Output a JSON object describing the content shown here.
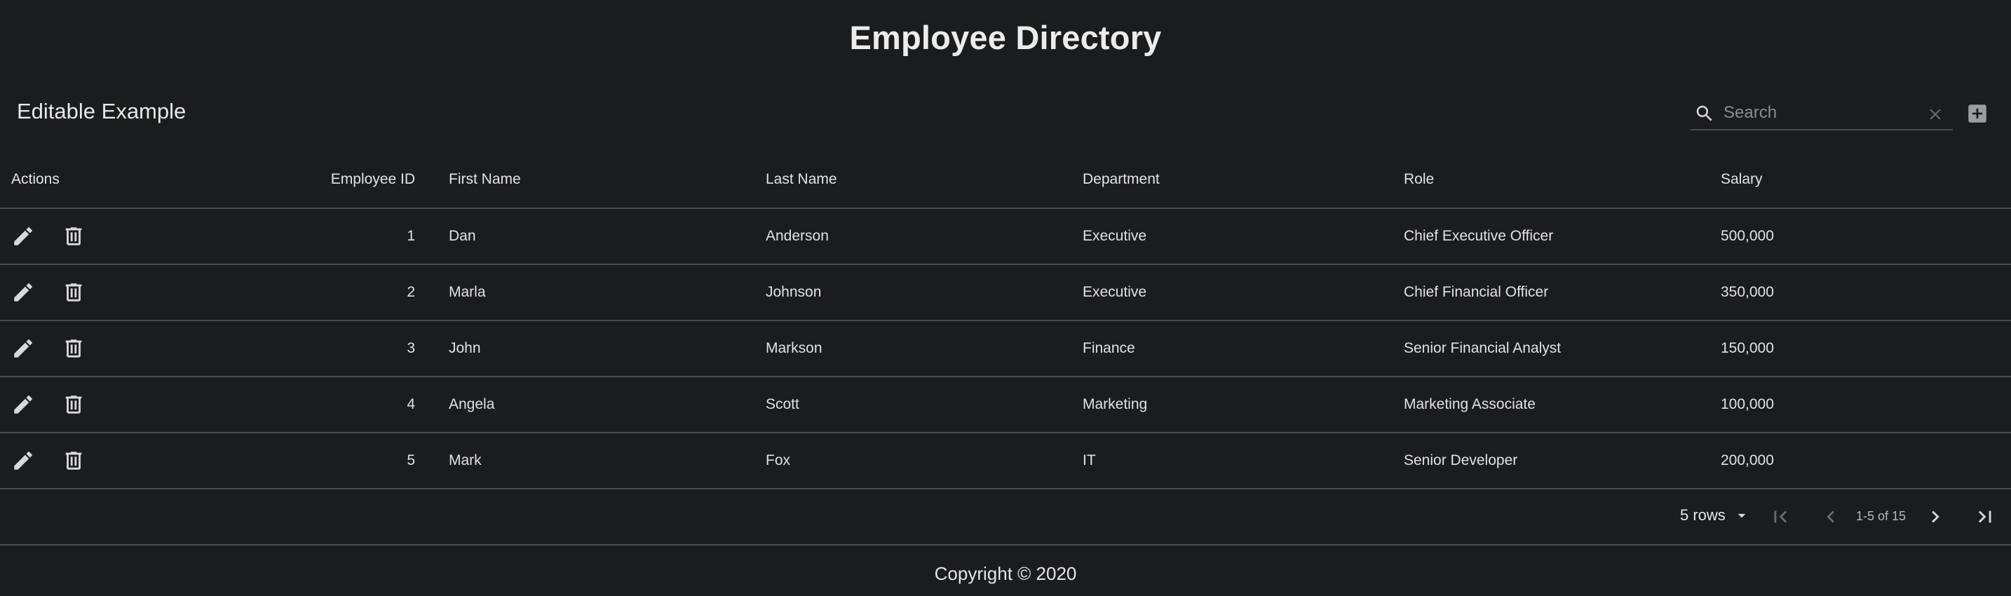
{
  "page_title": "Employee Directory",
  "toolbar": {
    "title": "Editable Example",
    "search_placeholder": "Search",
    "search_value": ""
  },
  "icons": {
    "search": "search-icon",
    "clear": "close-icon",
    "add": "add-box-icon",
    "edit": "pencil-icon",
    "delete": "trash-icon",
    "first_page": "first-page-icon",
    "prev_page": "chevron-left-icon",
    "next_page": "chevron-right-icon",
    "last_page": "last-page-icon",
    "dropdown": "arrow-drop-down-icon"
  },
  "table": {
    "headers": {
      "actions": "Actions",
      "employee_id": "Employee ID",
      "first_name": "First Name",
      "last_name": "Last Name",
      "department": "Department",
      "role": "Role",
      "salary": "Salary"
    },
    "rows": [
      {
        "employee_id": "1",
        "first_name": "Dan",
        "last_name": "Anderson",
        "department": "Executive",
        "role": "Chief Executive Officer",
        "salary": "500,000"
      },
      {
        "employee_id": "2",
        "first_name": "Marla",
        "last_name": "Johnson",
        "department": "Executive",
        "role": "Chief Financial Officer",
        "salary": "350,000"
      },
      {
        "employee_id": "3",
        "first_name": "John",
        "last_name": "Markson",
        "department": "Finance",
        "role": "Senior Financial Analyst",
        "salary": "150,000"
      },
      {
        "employee_id": "4",
        "first_name": "Angela",
        "last_name": "Scott",
        "department": "Marketing",
        "role": "Marketing Associate",
        "salary": "100,000"
      },
      {
        "employee_id": "5",
        "first_name": "Mark",
        "last_name": "Fox",
        "department": "IT",
        "role": "Senior Developer",
        "salary": "200,000"
      }
    ]
  },
  "pagination": {
    "rows_per_page_label": "5 rows",
    "range_label": "1-5 of 15"
  },
  "footer": {
    "copyright": "Copyright © 2020"
  },
  "colors": {
    "background": "#1b1c1e",
    "text": "#e6e6e6",
    "divider": "#4a4b4e",
    "icon": "#d9d9d9",
    "icon_disabled": "#6a6b6e"
  }
}
